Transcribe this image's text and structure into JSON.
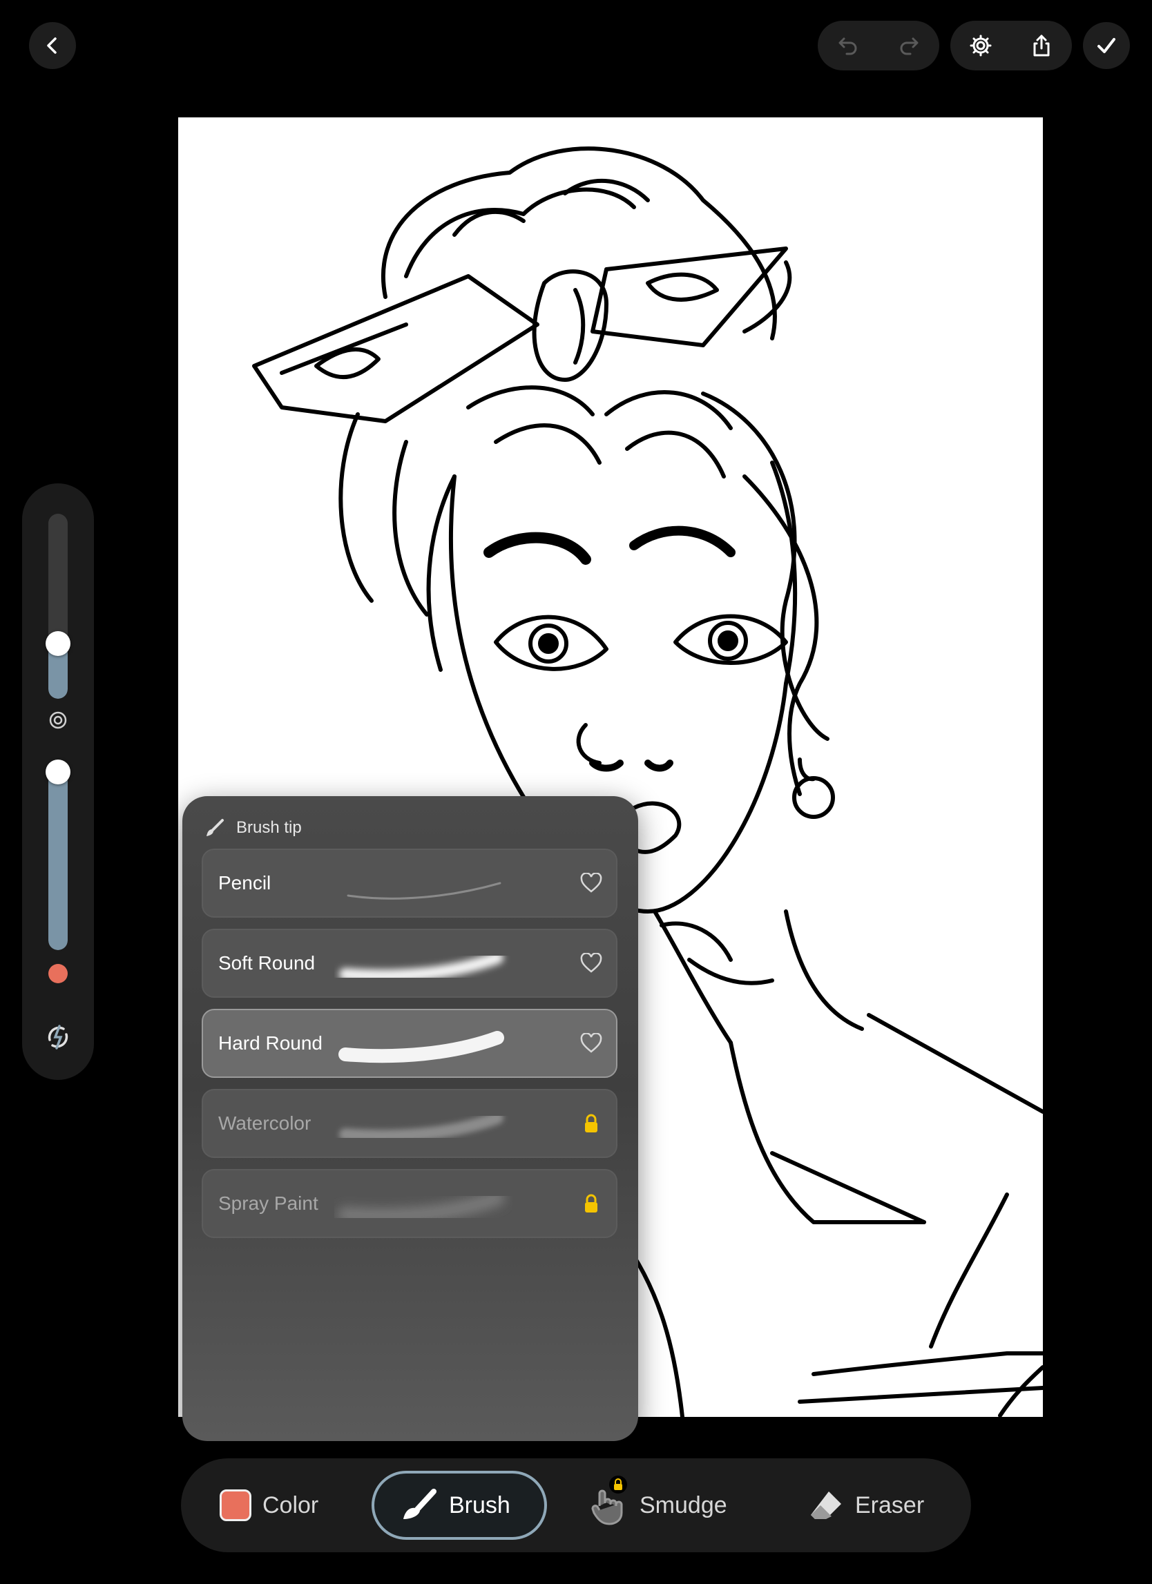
{
  "header": {
    "back_icon": "chevron-left-icon",
    "undo_icon": "undo-icon",
    "redo_icon": "redo-icon",
    "settings_icon": "gear-icon",
    "share_icon": "share-icon",
    "done_icon": "checkmark-icon"
  },
  "side_panel": {
    "size_level": 0.3,
    "opacity_level": 0.95,
    "size_icon": "concentric-circle-icon",
    "current_color": "#e8705c",
    "swap_icon": "pressure-swap-icon"
  },
  "brush_popover": {
    "title": "Brush tip",
    "title_icon": "brush-icon",
    "brushes": [
      {
        "label": "Pencil",
        "status": "heart-icon",
        "selected": false,
        "locked": false
      },
      {
        "label": "Soft Round",
        "status": "heart-icon",
        "selected": false,
        "locked": false
      },
      {
        "label": "Hard Round",
        "status": "heart-icon",
        "selected": true,
        "locked": false
      },
      {
        "label": "Watercolor",
        "status": "lock-icon",
        "selected": false,
        "locked": true
      },
      {
        "label": "Spray Paint",
        "status": "lock-icon",
        "selected": false,
        "locked": true
      }
    ]
  },
  "toolbar": {
    "color_label": "Color",
    "color_swatch": "#e8705c",
    "brush_label": "Brush",
    "smudge_label": "Smudge",
    "eraser_label": "Eraser",
    "active_tool": "Brush",
    "accent": "#8fa8b8",
    "lock_color": "#f5c400"
  }
}
